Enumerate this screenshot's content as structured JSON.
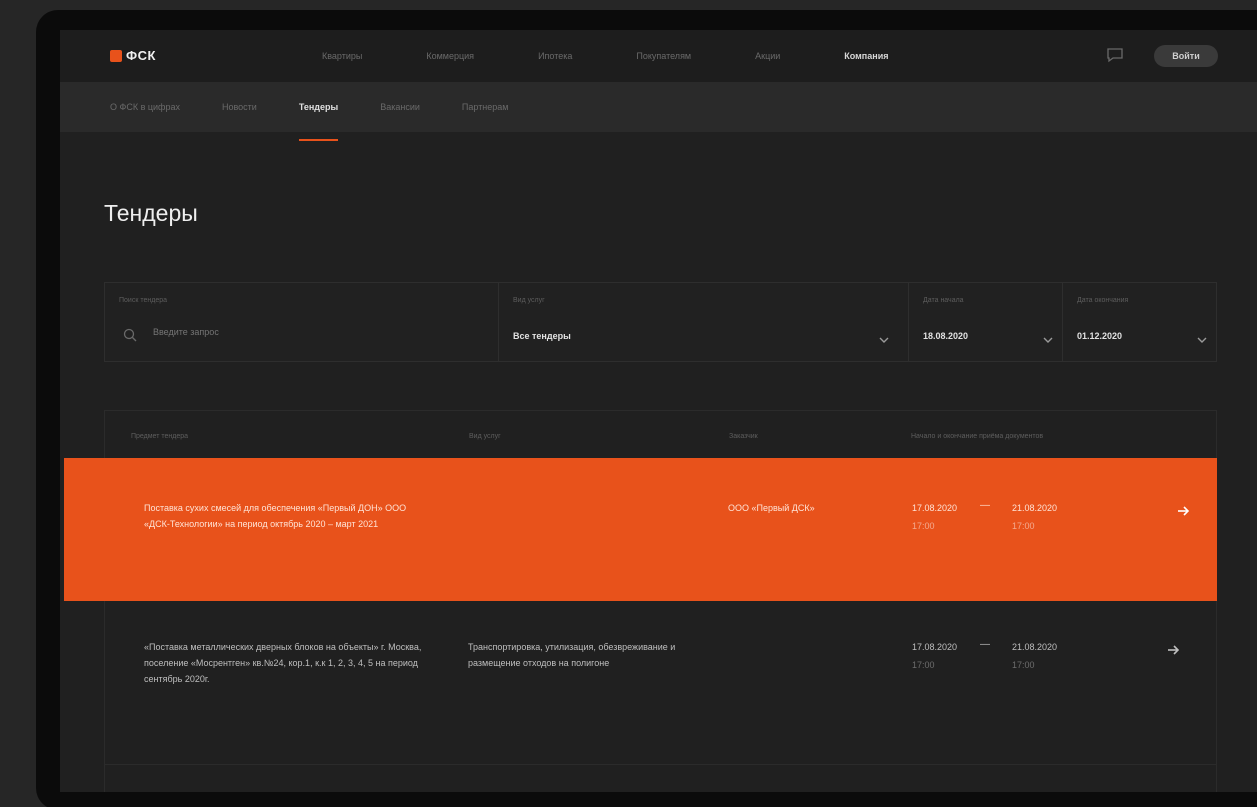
{
  "brand": {
    "name": "ФСК",
    "accent": "#e8521b"
  },
  "topnav": {
    "items": [
      "Квартиры",
      "Коммерция",
      "Ипотека",
      "Покупателям",
      "Акции",
      "Компания"
    ],
    "active_index": 5
  },
  "login_label": "Войти",
  "subnav": {
    "items": [
      "О ФСК в цифрах",
      "Новости",
      "Тендеры",
      "Вакансии",
      "Партнерам"
    ],
    "active_index": 2
  },
  "page": {
    "title": "Тендеры"
  },
  "filters": {
    "search": {
      "label": "Поиск тендера",
      "placeholder": "Введите запрос"
    },
    "type": {
      "label": "Вид услуг",
      "value": "Все тендеры"
    },
    "date_from": {
      "label": "Дата начала",
      "value": "18.08.2020"
    },
    "date_to": {
      "label": "Дата окончания",
      "value": "01.12.2020"
    }
  },
  "table": {
    "columns": [
      "Предмет тендера",
      "Вид услуг",
      "Заказчик",
      "Начало и окончание приёма документов"
    ],
    "rows": [
      {
        "subject": "Поставка сухих смесей для обеспечения «Первый ДОН» ООО «ДСК-Технологии» на период октябрь 2020 – март 2021",
        "service": "",
        "customer": "ООО «Первый ДСК»",
        "start_date": "17.08.2020",
        "start_time": "17:00",
        "end_date": "21.08.2020",
        "end_time": "17:00",
        "highlighted": true
      },
      {
        "subject": "«Поставка металлических дверных блоков на объекты» г. Москва, поселение «Мосрентген» кв.№24, кор.1, к.к 1, 2, 3, 4, 5 на период сентябрь 2020г.",
        "service": "Транспортировка, утилизация, обезвреживание и размещение отходов на полигоне",
        "customer": "",
        "start_date": "17.08.2020",
        "start_time": "17:00",
        "end_date": "21.08.2020",
        "end_time": "17:00",
        "highlighted": false
      }
    ]
  }
}
